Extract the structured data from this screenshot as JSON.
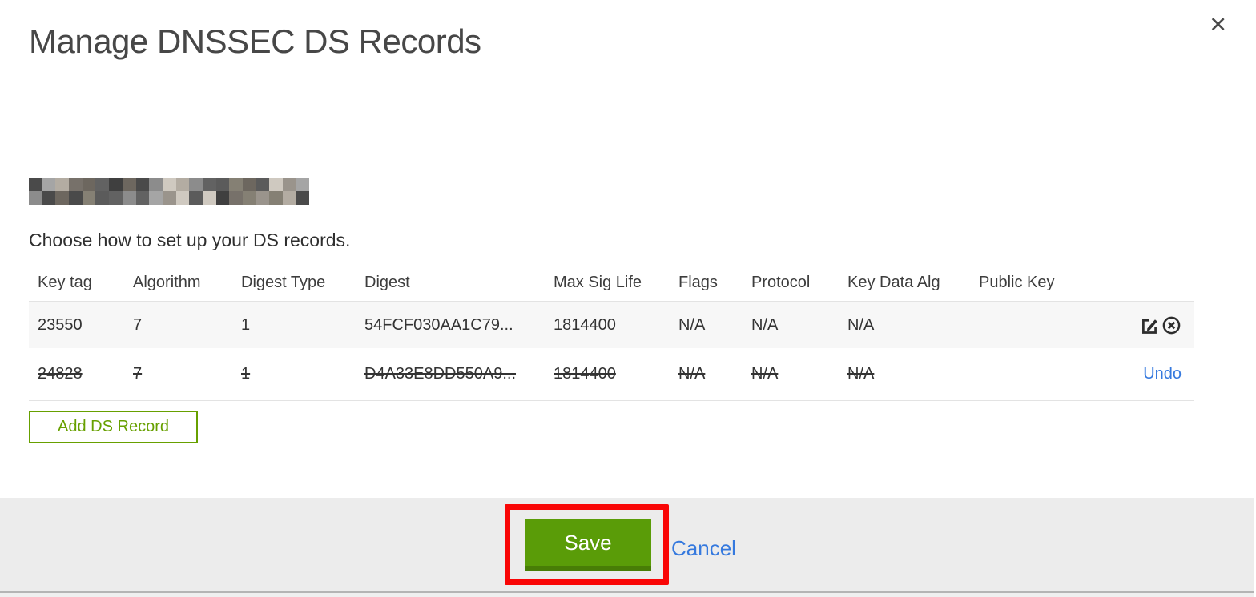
{
  "dialog": {
    "title": "Manage DNSSEC DS Records",
    "close_label": "✕",
    "instruction": "Choose how to set up your DS records.",
    "domain_redacted": true
  },
  "redaction": {
    "rows": 2,
    "cols": 21,
    "palette": [
      "#4a4a4a",
      "#77716a",
      "#9a948c",
      "#5b5b5b",
      "#8c8c8c",
      "#6d675f",
      "#b3aca2",
      "#3f3f3f",
      "#a5a5a5",
      "#858074",
      "#cfc9c0",
      "#626262"
    ]
  },
  "table": {
    "columns": [
      "Key tag",
      "Algorithm",
      "Digest Type",
      "Digest",
      "Max Sig Life",
      "Flags",
      "Protocol",
      "Key Data Alg",
      "Public Key"
    ],
    "rows": [
      {
        "key_tag": "23550",
        "algorithm": "7",
        "digest_type": "1",
        "digest": "54FCF030AA1C79...",
        "max_sig_life": "1814400",
        "flags": "N/A",
        "protocol": "N/A",
        "key_data_alg": "N/A",
        "public_key": "",
        "state": "normal",
        "actions": [
          "edit",
          "delete"
        ]
      },
      {
        "key_tag": "24828",
        "algorithm": "7",
        "digest_type": "1",
        "digest": "D4A33E8DD550A9...",
        "max_sig_life": "1814400",
        "flags": "N/A",
        "protocol": "N/A",
        "key_data_alg": "N/A",
        "public_key": "",
        "state": "deleted",
        "undo_label": "Undo"
      }
    ]
  },
  "buttons": {
    "add_record": "Add DS Record",
    "save": "Save",
    "cancel": "Cancel"
  },
  "annotation": {
    "shape": "rectangle",
    "color": "#f90606",
    "target": "save-button"
  },
  "colors": {
    "green_outline": "#67a000",
    "save_green": "#5a9c08",
    "save_green_dark": "#487d06",
    "link_blue": "#3579de",
    "footer_gray": "#ececec"
  }
}
